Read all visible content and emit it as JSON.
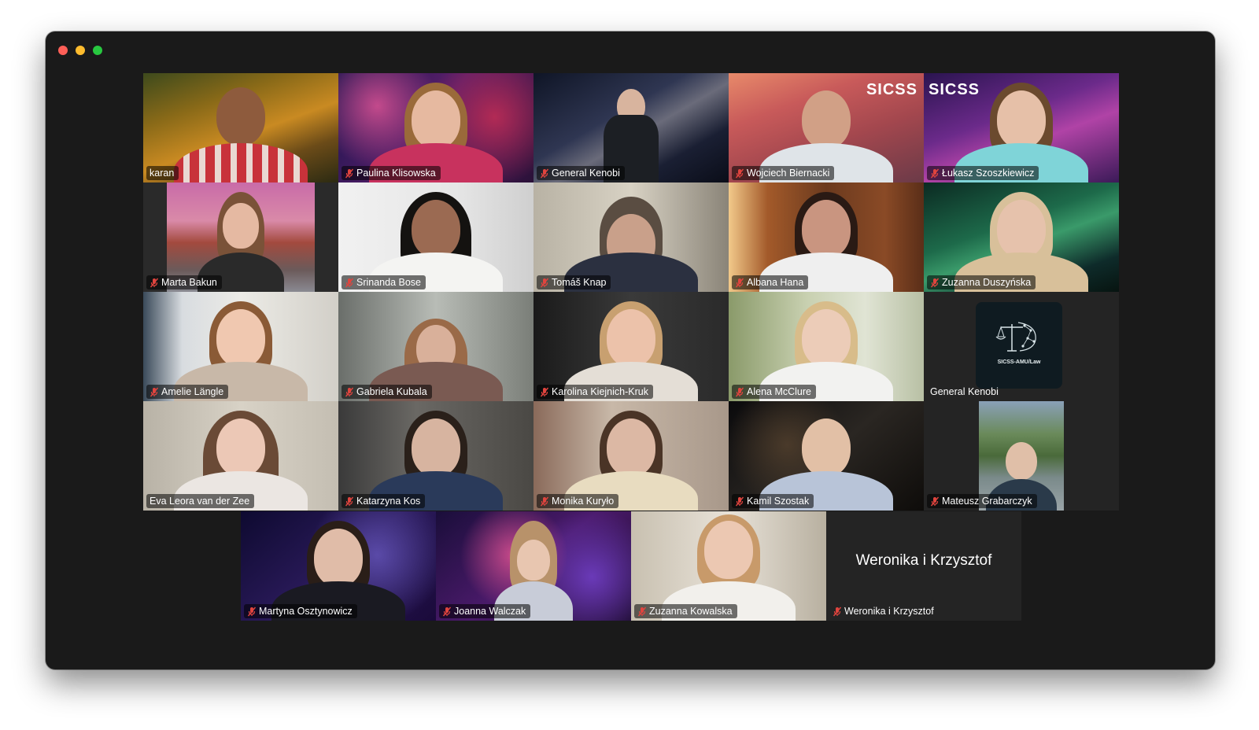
{
  "window": {
    "controls": {
      "close_color": "#ff5f57",
      "minimize_color": "#febc2e",
      "zoom_color": "#28c840"
    },
    "background": "#1a1a1a"
  },
  "participants": [
    {
      "name": "karan",
      "muted": false
    },
    {
      "name": "Paulina Klisowska",
      "muted": true
    },
    {
      "name": "General Kenobi",
      "muted": true
    },
    {
      "name": "Wojciech Biernacki",
      "muted": true,
      "overlay": "SICSS"
    },
    {
      "name": "Łukasz Szoszkiewicz",
      "muted": true,
      "overlay": "SICSS"
    },
    {
      "name": "Marta Bakun",
      "muted": true
    },
    {
      "name": "Srinanda Bose",
      "muted": true
    },
    {
      "name": "Tomáš Knap",
      "muted": true
    },
    {
      "name": "Albana Hana",
      "muted": true
    },
    {
      "name": "Zuzanna Duszyńska",
      "muted": true
    },
    {
      "name": "Amelie Längle",
      "muted": true
    },
    {
      "name": "Gabriela Kubala",
      "muted": true
    },
    {
      "name": "Karolina Kiejnich-Kruk",
      "muted": true
    },
    {
      "name": "Alena McClure",
      "muted": true
    },
    {
      "name": "General Kenobi",
      "muted": false,
      "logo_text": "SICSS-AMU/Law"
    },
    {
      "name": "Eva Leora van der Zee",
      "muted": false,
      "active_speaker": true
    },
    {
      "name": "Katarzyna Kos",
      "muted": true
    },
    {
      "name": "Monika Kuryło",
      "muted": true
    },
    {
      "name": "Kamil Szostak",
      "muted": true
    },
    {
      "name": "Mateusz Grabarczyk",
      "muted": true
    },
    {
      "name": "Martyna Osztynowicz",
      "muted": true
    },
    {
      "name": "Joanna Walczak",
      "muted": true
    },
    {
      "name": "Zuzanna Kowalska",
      "muted": true
    },
    {
      "name": "Weronika i Krzysztof",
      "muted": true,
      "video_off": true,
      "display_name": "Weronika i Krzysztof"
    }
  ],
  "colors": {
    "active_speaker_border": "#3ec04d",
    "muted_icon": "#e0443e"
  }
}
